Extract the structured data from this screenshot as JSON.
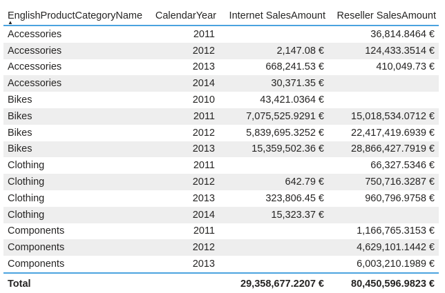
{
  "table": {
    "columns": [
      "EnglishProductCategoryName",
      "CalendarYear",
      "Internet SalesAmount",
      "Reseller SalesAmount"
    ],
    "sort_icon": "sort-ascending-icon",
    "rows": [
      [
        "Accessories",
        "2011",
        "",
        "36,814.8464 €"
      ],
      [
        "Accessories",
        "2012",
        "2,147.08 €",
        "124,433.3514 €"
      ],
      [
        "Accessories",
        "2013",
        "668,241.53 €",
        "410,049.73 €"
      ],
      [
        "Accessories",
        "2014",
        "30,371.35 €",
        ""
      ],
      [
        "Bikes",
        "2010",
        "43,421.0364 €",
        ""
      ],
      [
        "Bikes",
        "2011",
        "7,075,525.9291 €",
        "15,018,534.0712 €"
      ],
      [
        "Bikes",
        "2012",
        "5,839,695.3252 €",
        "22,417,419.6939 €"
      ],
      [
        "Bikes",
        "2013",
        "15,359,502.36 €",
        "28,866,427.7919 €"
      ],
      [
        "Clothing",
        "2011",
        "",
        "66,327.5346 €"
      ],
      [
        "Clothing",
        "2012",
        "642.79 €",
        "750,716.3287 €"
      ],
      [
        "Clothing",
        "2013",
        "323,806.45 €",
        "960,796.9758 €"
      ],
      [
        "Clothing",
        "2014",
        "15,323.37 €",
        ""
      ],
      [
        "Components",
        "2011",
        "",
        "1,166,765.3153 €"
      ],
      [
        "Components",
        "2012",
        "",
        "4,629,101.1442 €"
      ],
      [
        "Components",
        "2013",
        "",
        "6,003,210.1989 €"
      ]
    ],
    "total": [
      "Total",
      "",
      "29,358,677.2207 €",
      "80,450,596.9823 €"
    ]
  }
}
